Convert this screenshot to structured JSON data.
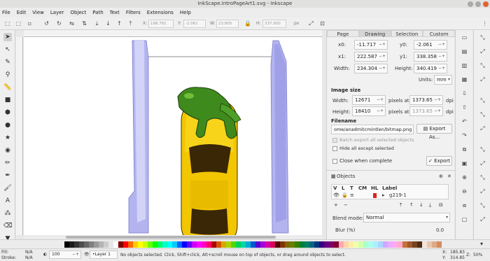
{
  "window": {
    "title": "InkScape.IntroPageArt1.svg - Inkscape"
  },
  "menu": [
    "File",
    "Edit",
    "View",
    "Layer",
    "Object",
    "Path",
    "Text",
    "Filters",
    "Extensions",
    "Help"
  ],
  "toolbar": {
    "x_label": "X:",
    "x_value": "198.781",
    "y_label": "Y:",
    "y_value": "-2.061",
    "w_label": "W:",
    "w_value": "23.805",
    "h_label": "H:",
    "h_value": "337.950",
    "unit": "px"
  },
  "export": {
    "tabs": [
      "Page",
      "Drawing",
      "Selection",
      "Custom"
    ],
    "active_tab": "Drawing",
    "x0_label": "x0:",
    "x0": "-11.717",
    "y0_label": "y0:",
    "y0": "-2.061",
    "x1_label": "x1:",
    "x1": "222.587",
    "y1_label": "y1:",
    "y1": "338.358",
    "width_label": "Width:",
    "width": "234.304",
    "height_label": "Height:",
    "height": "340.419",
    "units_label": "Units:",
    "units": "mm",
    "image_size_header": "Image size",
    "img_width_label": "Width:",
    "img_width": "12671",
    "img_height_label": "Height:",
    "img_height": "18410",
    "pixels_at": "pixels at",
    "dpi1": "1373.65",
    "dpi2": "1373.65",
    "dpi_label": "dpi",
    "filename_header": "Filename",
    "filename": "ome/anadmitcmintlen/bitmap.png",
    "export_as_label": "Export As...",
    "batch_label": "Batch export all selected objects",
    "hide_label": "Hide all except selected",
    "close_label": "Close when complete",
    "export_label": "Export"
  },
  "objects": {
    "header": "Objects",
    "cols": [
      "V",
      "L",
      "T",
      "CM",
      "HL",
      "Label"
    ],
    "item_label": "g219-1",
    "blend_label": "Blend mode:",
    "blend_value": "Normal",
    "blur_label": "Blur (%)",
    "blur_value": "0.0"
  },
  "status": {
    "fill_label": "Fill:",
    "fill_value": "N/A",
    "stroke_label": "Stroke:",
    "stroke_value": "N/A",
    "opacity": "100",
    "layer": "•Layer 1",
    "message": "No objects selected. Click, Shift+click, Alt+scroll mouse on top of objects, or drag around objects to select.",
    "x_label": "X:",
    "x": "185.83",
    "y_label": "Y:",
    "y": "314.85",
    "z_label": "Z:",
    "zoom": "50%"
  },
  "palette_colors": [
    "#000000",
    "#1a1a1a",
    "#333333",
    "#4d4d4d",
    "#666666",
    "#808080",
    "#999999",
    "#b3b3b3",
    "#cccccc",
    "#e6e6e6",
    "#ffffff",
    "#800000",
    "#ff0000",
    "#ff6600",
    "#ffcc00",
    "#ffff00",
    "#ccff00",
    "#66ff00",
    "#00ff00",
    "#00ff66",
    "#00ffcc",
    "#00ffff",
    "#00ccff",
    "#0066ff",
    "#0000ff",
    "#6600ff",
    "#cc00ff",
    "#ff00ff",
    "#ff00cc",
    "#ff0066",
    "#aa0000",
    "#d45500",
    "#d4aa00",
    "#aad400",
    "#55d400",
    "#00d455",
    "#00d4aa",
    "#00aad4",
    "#0055d4",
    "#5500d4",
    "#aa00d4",
    "#d400aa",
    "#d40055",
    "#550000",
    "#803300",
    "#806600",
    "#668000",
    "#338000",
    "#008033",
    "#008066",
    "#006680",
    "#003380",
    "#330080",
    "#660080",
    "#800066",
    "#800033",
    "#ffaaaa",
    "#ffd5aa",
    "#ffeeaa",
    "#eeffaa",
    "#d5ffaa",
    "#aaffcc",
    "#aaffee",
    "#aaeeff",
    "#aad5ff",
    "#ccaaff",
    "#eeaaff",
    "#ffaaee",
    "#ffaacc",
    "#c87137",
    "#a05a2c",
    "#784421",
    "#502d16",
    "#f4e3d7",
    "#e9c6af",
    "#deaa87",
    "#d38d5f"
  ]
}
